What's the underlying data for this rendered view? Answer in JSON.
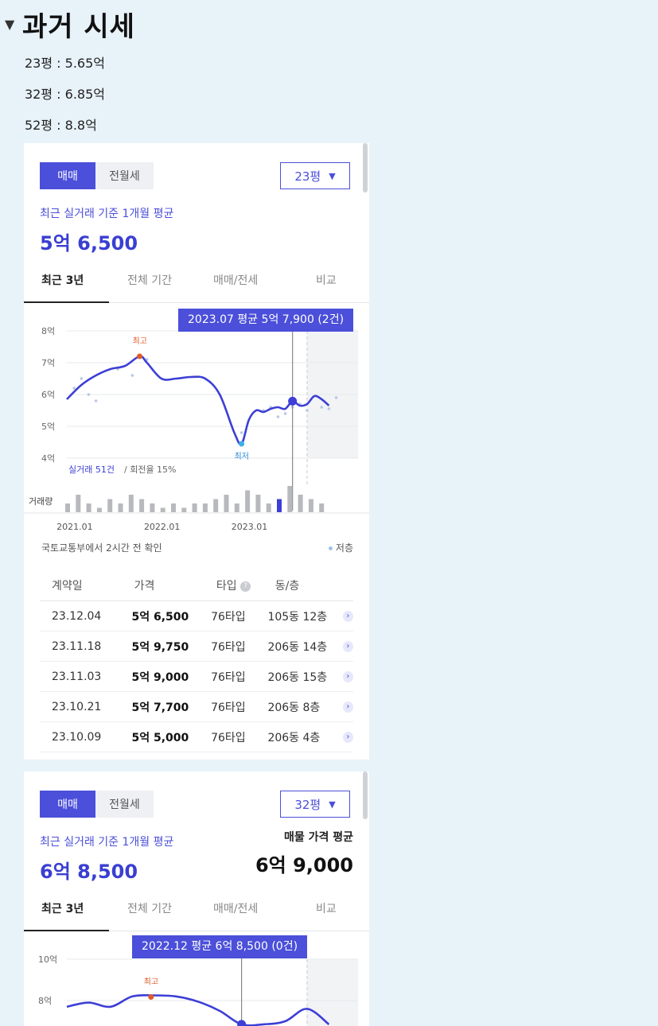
{
  "section": {
    "title": "과거 시세"
  },
  "past_prices": [
    {
      "text": "23평 : 5.65억"
    },
    {
      "text": "32평 : 6.85억"
    },
    {
      "text": "52평 : 8.8억"
    }
  ],
  "card1": {
    "seg_sale": "매매",
    "seg_rent": "전월세",
    "size": "23평",
    "sub_label": "최근 실거래 기준 1개월 평균",
    "price": "5억 6,500",
    "tabs": [
      "최근 3년",
      "전체 기간",
      "매매/전세",
      "비교"
    ],
    "tooltip": "2023.07 평균 5억 7,900 (2건)",
    "high_label": "최고",
    "low_label": "최저",
    "stat_count": "실거래 51건",
    "stat_rate": " / 회전율 15%",
    "volume_label": "거래량",
    "confirm": "국토교통부에서 2시간 전 확인",
    "legend": "저층",
    "table_headers": [
      "계약일",
      "가격",
      "타입",
      "동/층"
    ],
    "rows": [
      {
        "date": "23.12.04",
        "price": "5억 6,500",
        "type": "76타입",
        "unit": "105동 12층"
      },
      {
        "date": "23.11.18",
        "price": "5억 9,750",
        "type": "76타입",
        "unit": "206동 14층"
      },
      {
        "date": "23.11.03",
        "price": "5억 9,000",
        "type": "76타입",
        "unit": "206동 15층"
      },
      {
        "date": "23.10.21",
        "price": "5억 7,700",
        "type": "76타입",
        "unit": "206동 8층"
      },
      {
        "date": "23.10.09",
        "price": "5억 5,000",
        "type": "76타입",
        "unit": "206동 4층"
      }
    ]
  },
  "card2": {
    "seg_sale": "매매",
    "seg_rent": "전월세",
    "size": "32평",
    "sub_label": "최근 실거래 기준 1개월 평균",
    "price": "6억 8,500",
    "alt_label": "매물 가격 평균",
    "alt_price": "6억 9,000",
    "tabs": [
      "최근 3년",
      "전체 기간",
      "매매/전세",
      "비교"
    ],
    "tooltip": "2022.12 평균 6억 8,500 (0건)",
    "high_label": "최고"
  },
  "chart_data": [
    {
      "type": "line",
      "y_ticks": [
        "8억",
        "7억",
        "6억",
        "5억",
        "4억"
      ],
      "x_ticks": [
        "2021.01",
        "2022.01",
        "2023.01"
      ],
      "ylim": [
        4,
        8
      ],
      "series": [
        {
          "x": [
            "2020.12",
            "2021.02",
            "2021.04",
            "2021.06",
            "2021.08",
            "2021.10",
            "2021.11",
            "2022.01",
            "2022.03",
            "2022.05",
            "2022.07",
            "2022.09",
            "2022.11",
            "2022.12",
            "2023.01",
            "2023.02",
            "2023.03",
            "2023.04",
            "2023.05",
            "2023.06",
            "2023.07",
            "2023.08",
            "2023.09",
            "2023.10",
            "2023.11",
            "2023.12"
          ],
          "y": [
            5.85,
            6.3,
            6.6,
            6.8,
            6.9,
            7.2,
            7.0,
            6.5,
            6.5,
            6.55,
            6.5,
            6.0,
            4.8,
            4.45,
            5.2,
            5.5,
            5.45,
            5.55,
            5.6,
            5.55,
            5.79,
            5.65,
            5.7,
            5.95,
            5.85,
            5.65
          ]
        }
      ],
      "annotations": {
        "high": 7.2,
        "low": 4.45,
        "selected": "2023.07"
      },
      "volume": [
        2,
        4,
        2,
        1,
        3,
        2,
        4,
        3,
        2,
        1,
        2,
        1,
        2,
        2,
        3,
        4,
        2,
        5,
        4,
        2,
        3,
        6,
        4,
        3,
        2
      ]
    },
    {
      "type": "line",
      "y_ticks": [
        "10억",
        "8억"
      ],
      "ylim": [
        6,
        10
      ],
      "series": [
        {
          "x": [
            "2020.12",
            "2021.03",
            "2021.06",
            "2021.09",
            "2021.12",
            "2022.03",
            "2022.06",
            "2022.09",
            "2022.12",
            "2023.03",
            "2023.06",
            "2023.09",
            "2023.12"
          ],
          "y": [
            7.7,
            7.9,
            7.7,
            8.2,
            8.25,
            8.2,
            7.95,
            7.5,
            6.85,
            6.85,
            7.0,
            7.6,
            6.85
          ]
        }
      ],
      "annotations": {
        "high": 8.25,
        "selected": "2022.12"
      }
    }
  ]
}
